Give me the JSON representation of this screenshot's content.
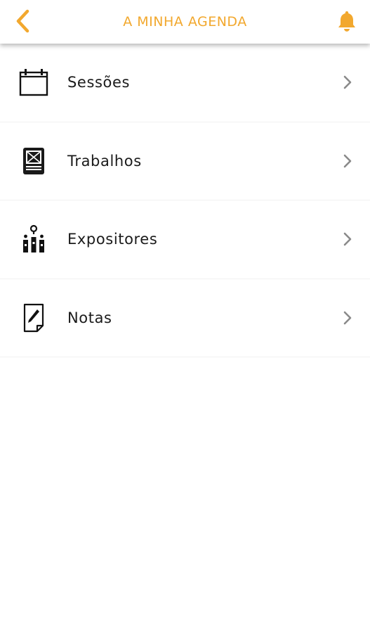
{
  "header": {
    "title": "A MINHA AGENDA",
    "back_icon": "chevron-left-icon",
    "notification_icon": "bell-icon",
    "accent_color": "#f2a82e"
  },
  "menu": {
    "items": [
      {
        "label": "Sessões",
        "icon": "calendar-icon"
      },
      {
        "label": "Trabalhos",
        "icon": "poster-icon"
      },
      {
        "label": "Expositores",
        "icon": "exhibitors-icon"
      },
      {
        "label": "Notas",
        "icon": "note-icon"
      }
    ],
    "chevron_icon": "chevron-right-icon",
    "text_color": "#1b1b1b",
    "chevron_color": "#8a8a8a"
  }
}
